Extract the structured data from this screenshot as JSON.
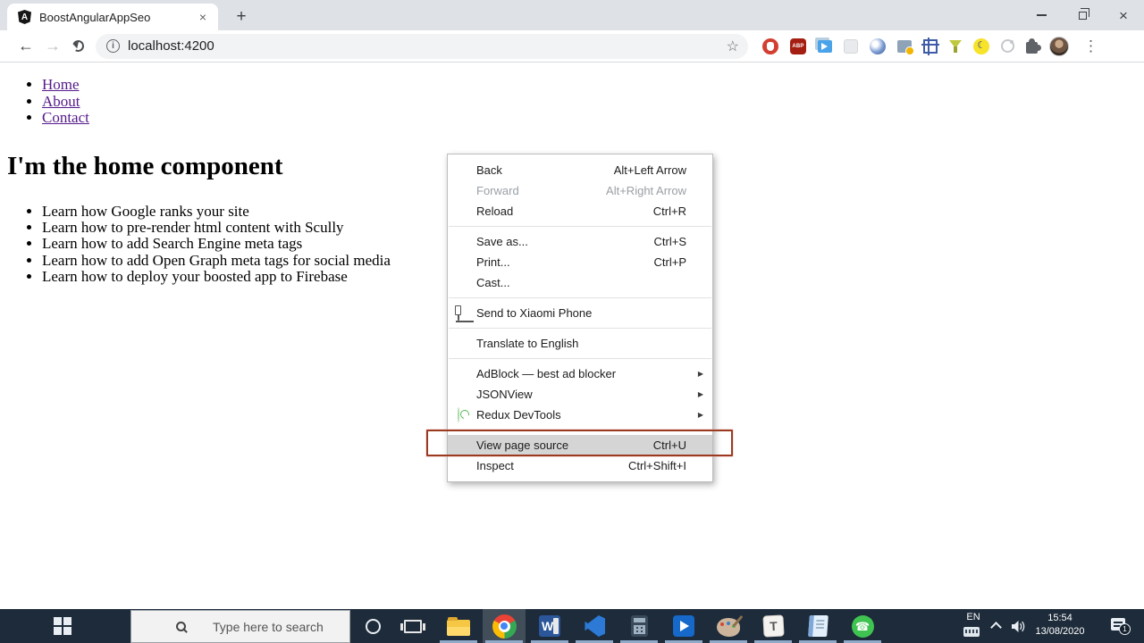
{
  "browser": {
    "tab": {
      "favicon_letter": "A",
      "title": "BoostAngularAppSeo"
    },
    "address": {
      "url": "localhost:4200"
    },
    "extensions": {
      "abp_label": "ABP"
    }
  },
  "glyphs": {
    "back": "←",
    "forward": "→",
    "close": "×",
    "new_tab": "+",
    "info": "i",
    "star": "☆",
    "overflow": "⋮",
    "submenu_arrow": "▶",
    "moon": "☾",
    "phone_handset": "☎"
  },
  "page": {
    "nav": [
      {
        "label": "Home"
      },
      {
        "label": "About"
      },
      {
        "label": "Contact"
      }
    ],
    "heading": "I'm the home component",
    "features": [
      "Learn how Google ranks your site",
      "Learn how to pre-render html content with Scully",
      "Learn how to add Search Engine meta tags",
      "Learn how to add Open Graph meta tags for social media",
      "Learn how to deploy your boosted app to Firebase"
    ]
  },
  "context_menu": {
    "items": [
      {
        "label": "Back",
        "shortcut": "Alt+Left Arrow"
      },
      {
        "label": "Forward",
        "shortcut": "Alt+Right Arrow",
        "disabled": true
      },
      {
        "label": "Reload",
        "shortcut": "Ctrl+R"
      },
      {
        "label": "Save as...",
        "shortcut": "Ctrl+S"
      },
      {
        "label": "Print...",
        "shortcut": "Ctrl+P"
      },
      {
        "label": "Cast...",
        "shortcut": ""
      },
      {
        "label": "Send to Xiaomi Phone",
        "shortcut": ""
      },
      {
        "label": "Translate to English",
        "shortcut": ""
      },
      {
        "label": "AdBlock — best ad blocker",
        "shortcut": "",
        "has_submenu": true
      },
      {
        "label": "JSONView",
        "shortcut": "",
        "has_submenu": true
      },
      {
        "label": "Redux DevTools",
        "shortcut": "",
        "has_submenu": true
      },
      {
        "label": "View page source",
        "shortcut": "Ctrl+U",
        "highlighted": true
      },
      {
        "label": "Inspect",
        "shortcut": "Ctrl+Shift+I"
      }
    ]
  },
  "annotation": {
    "shape": "rectangle",
    "color": "#9c3a1f",
    "target": "View page source"
  },
  "taskbar": {
    "search_placeholder": "Type here to search",
    "apps": [
      {
        "name": "task-view"
      },
      {
        "name": "file-explorer",
        "running": true
      },
      {
        "name": "chrome",
        "running": true,
        "active": true
      },
      {
        "name": "word",
        "letter": "W",
        "running": true
      },
      {
        "name": "vscode",
        "running": true
      },
      {
        "name": "calculator",
        "running": true
      },
      {
        "name": "share-app",
        "running": true
      },
      {
        "name": "paint-palette-app",
        "running": true
      },
      {
        "name": "typora",
        "letter": "T",
        "running": true
      },
      {
        "name": "notes-app",
        "running": true
      },
      {
        "name": "whatsapp",
        "running": true
      }
    ],
    "tray": {
      "language": "EN",
      "time": "15:54",
      "date": "13/08/2020",
      "notification_count": "1"
    }
  }
}
